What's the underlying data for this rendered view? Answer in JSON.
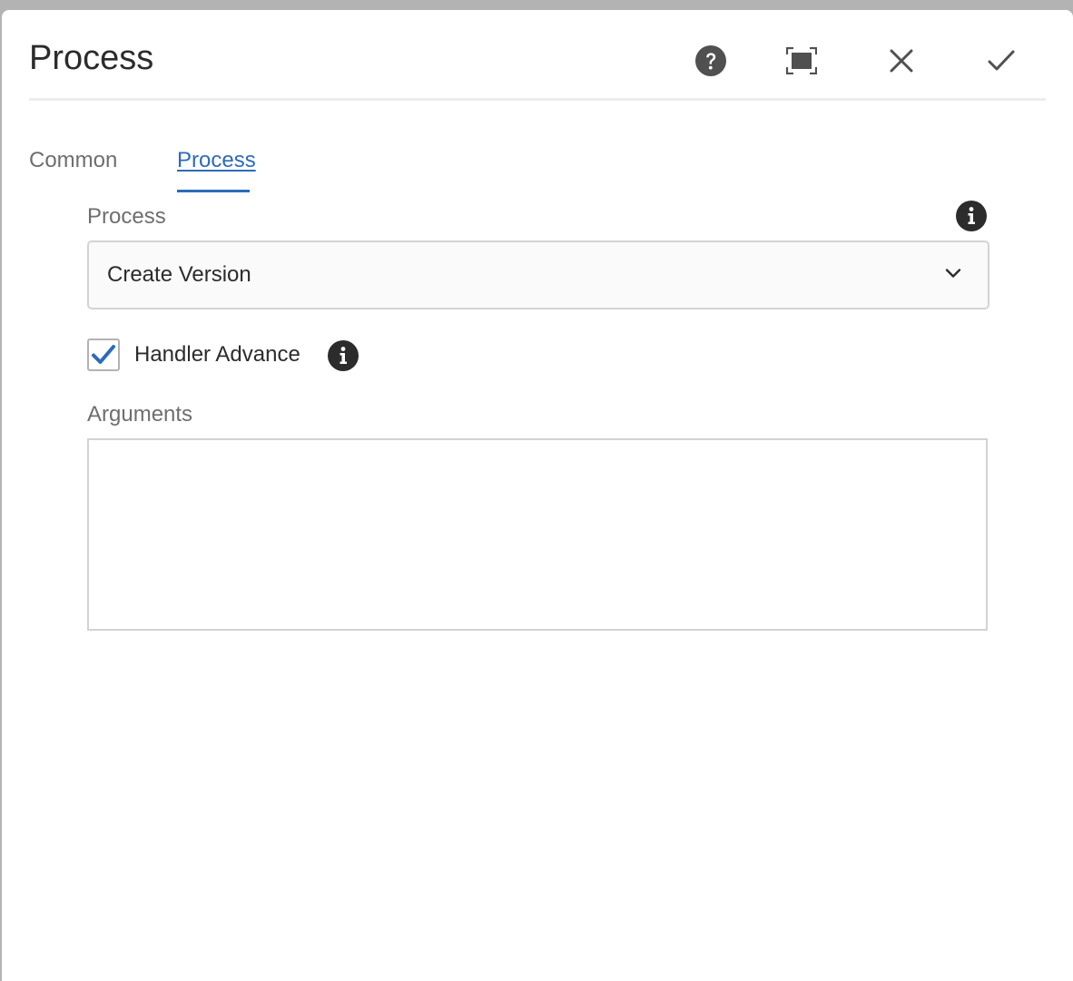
{
  "dialog": {
    "title": "Process",
    "buttons": {
      "help_icon": "help-icon",
      "fullscreen_icon": "fullscreen-icon",
      "close_icon": "close-icon",
      "done_icon": "checkmark-icon"
    }
  },
  "tabs": [
    {
      "label": "Common",
      "active": false
    },
    {
      "label": "Process",
      "active": true
    }
  ],
  "form": {
    "process": {
      "label": "Process",
      "value": "Create Version"
    },
    "handler_advance": {
      "label": "Handler Advance",
      "checked": true
    },
    "arguments": {
      "label": "Arguments",
      "value": ""
    }
  },
  "colors": {
    "accent": "#2d6bb9",
    "icon_dark": "#2c2c2c",
    "icon_gray": "#505050"
  }
}
